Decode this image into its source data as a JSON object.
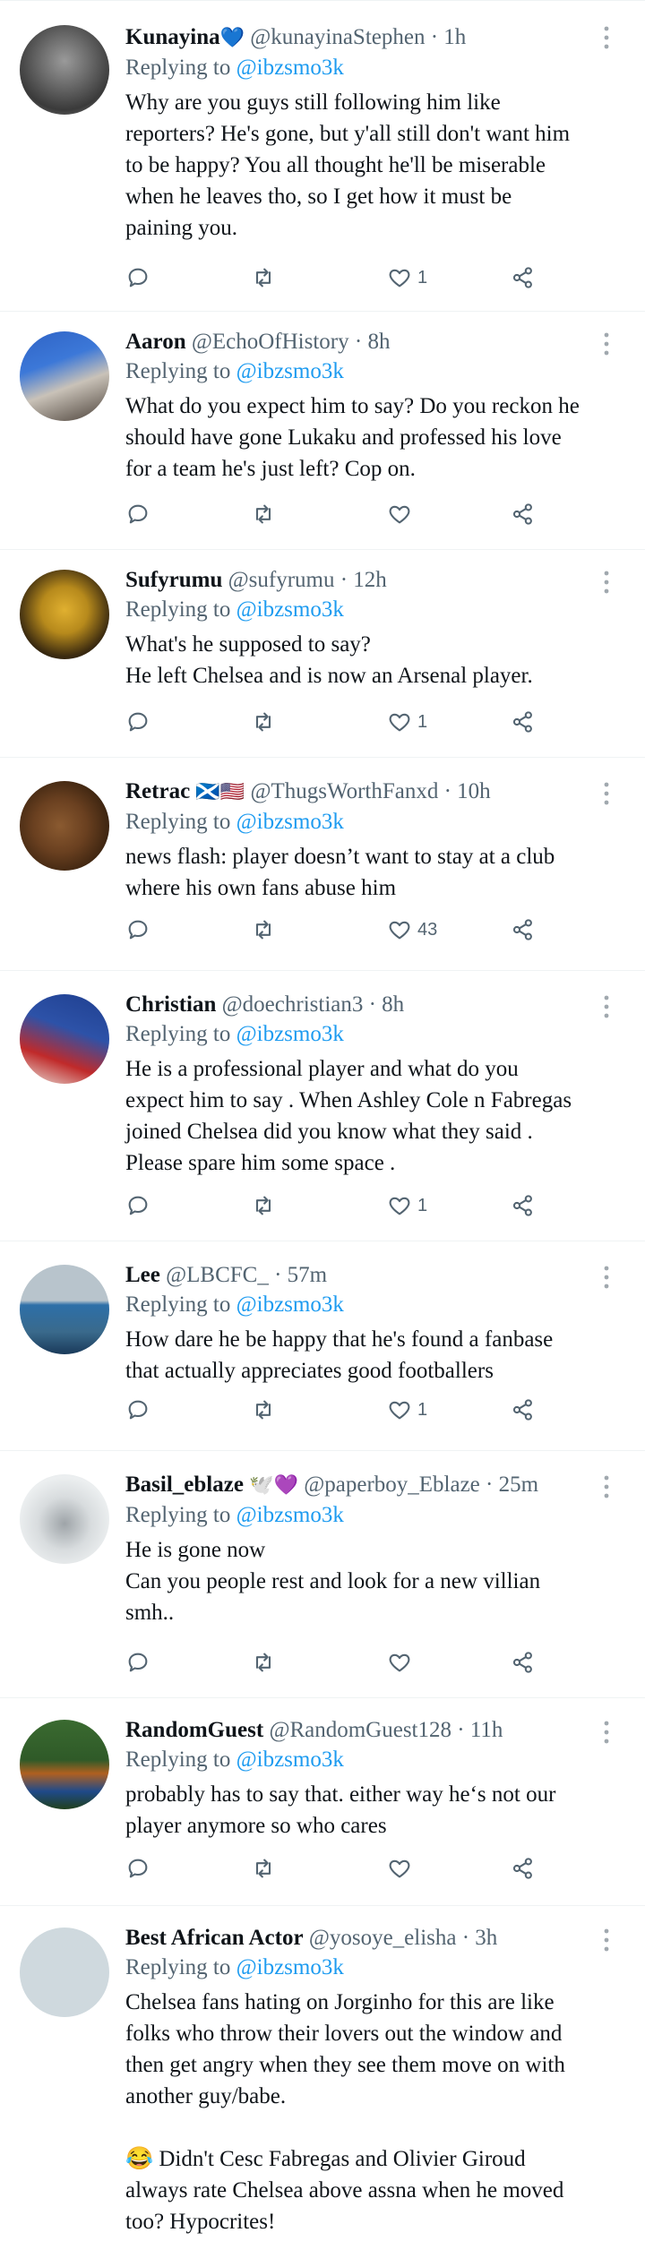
{
  "colors": {
    "link": "#1d9bf0",
    "muted": "#536471",
    "text": "#0f1419",
    "divider": "#eff3f4"
  },
  "replying_prefix": "Replying to",
  "tweets": [
    {
      "name": "Kunayina",
      "name_emoji": "💙",
      "handle": "@kunayinaStephen",
      "time": "· 1h",
      "replying_to": "@ibzsmo3k",
      "text": "Why are you guys still following him like\nreporters? He's gone, but y'all still don't want him\nto be happy? You all thought he'll be miserable\nwhen he leaves tho, so I get how it must be\npaining you.",
      "likes": "1"
    },
    {
      "name": "Aaron",
      "name_emoji": "",
      "handle": "@EchoOfHistory",
      "time": "· 8h",
      "replying_to": "@ibzsmo3k",
      "text": "What do you expect him to say? Do you reckon he\nshould have gone Lukaku and professed his love\nfor a team he's just left? Cop on.",
      "likes": ""
    },
    {
      "name": "Sufyrumu",
      "name_emoji": "",
      "handle": "@sufyrumu",
      "time": "· 12h",
      "replying_to": "@ibzsmo3k",
      "text": "What's he supposed to say?\nHe left Chelsea and is now an Arsenal player.",
      "likes": "1"
    },
    {
      "name": "Retrac",
      "name_emoji": "🏴󠁧󠁢󠁳󠁣󠁴󠁿🇺🇸",
      "handle": "@ThugsWorthFanxd",
      "time": "· 10h",
      "replying_to": "@ibzsmo3k",
      "text": "news flash: player doesn’t want to stay at a club\nwhere his own fans abuse him",
      "likes": "43"
    },
    {
      "name": "Christian",
      "name_emoji": "",
      "handle": "@doechristian3",
      "time": "· 8h",
      "replying_to": "@ibzsmo3k",
      "text": "He is a professional player and what do you\nexpect him to say . When Ashley Cole n Fabregas\njoined Chelsea did you know what they said .\nPlease spare him some space .",
      "likes": "1"
    },
    {
      "name": "Lee",
      "name_emoji": "",
      "handle": "@LBCFC_",
      "time": "· 57m",
      "replying_to": "@ibzsmo3k",
      "text": "How dare he be happy that he's found a fanbase\nthat actually appreciates good footballers",
      "likes": "1"
    },
    {
      "name": "Basil_eblaze",
      "name_emoji": "🕊️💜",
      "handle": "@paperboy_Eblaze",
      "time": "· 25m",
      "replying_to": "@ibzsmo3k",
      "text": "He is gone now\nCan you people rest and look for a new villian\nsmh..",
      "likes": ""
    },
    {
      "name": "RandomGuest",
      "name_emoji": "",
      "handle": "@RandomGuest128",
      "time": "· 11h",
      "replying_to": "@ibzsmo3k",
      "text": "probably has to say that. either way he‘s not our\nplayer anymore so who cares",
      "likes": ""
    },
    {
      "name": "Best African Actor",
      "name_emoji": "",
      "handle": "@yosoye_elisha",
      "time": "· 3h",
      "replying_to": "@ibzsmo3k",
      "text": "Chelsea fans hating on Jorginho for this are like\nfolks who throw their lovers out the window and\nthen get angry when they see them move on with\nanother guy/babe.\n\n😂 Didn't Cesc Fabregas and Olivier Giroud\nalways rate Chelsea above assna when he moved\ntoo? Hypocrites!",
      "likes": ""
    }
  ]
}
